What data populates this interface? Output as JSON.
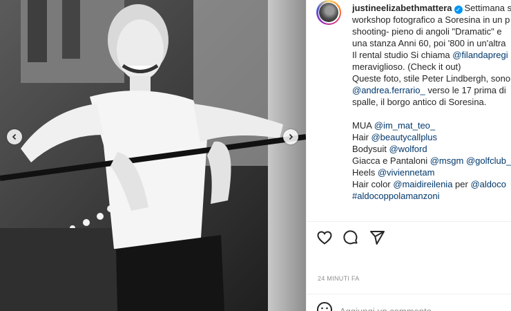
{
  "post": {
    "username": "justineelizabethmattera",
    "caption_lines": [
      {
        "parts": [
          {
            "text": "Settimana s",
            "link": false
          }
        ]
      },
      {
        "parts": [
          {
            "text": "workshop fotografico a Soresina in un p",
            "link": false
          }
        ]
      },
      {
        "parts": [
          {
            "text": "shooting- pieno di angoli \"Dramatic\" e",
            "link": false
          }
        ]
      },
      {
        "parts": [
          {
            "text": "una stanza Anni 60, poi '800 in un'altra",
            "link": false
          }
        ]
      },
      {
        "parts": [
          {
            "text": "Il rental studio Si chiama ",
            "link": false
          },
          {
            "text": "@filandapregi",
            "link": true
          }
        ]
      },
      {
        "parts": [
          {
            "text": "meraviglioso. (Check it out)",
            "link": false
          }
        ]
      },
      {
        "parts": [
          {
            "text": "Queste foto, stile Peter Lindbergh, sono",
            "link": false
          }
        ]
      },
      {
        "parts": [
          {
            "text": "@andrea.ferrario_",
            "link": true
          },
          {
            "text": " verso le 17 prima di",
            "link": false
          }
        ]
      },
      {
        "parts": [
          {
            "text": "spalle, il borgo antico di Soresina.",
            "link": false
          }
        ]
      },
      {
        "parts": []
      },
      {
        "parts": [
          {
            "text": "MUA ",
            "link": false
          },
          {
            "text": "@im_mat_teo_",
            "link": true
          }
        ]
      },
      {
        "parts": [
          {
            "text": "Hair ",
            "link": false
          },
          {
            "text": "@beautycallplus",
            "link": true
          }
        ]
      },
      {
        "parts": [
          {
            "text": "Bodysuit ",
            "link": false
          },
          {
            "text": "@wolford",
            "link": true
          }
        ]
      },
      {
        "parts": [
          {
            "text": "Giacca e Pantaloni ",
            "link": false
          },
          {
            "text": "@msgm",
            "link": true
          },
          {
            "text": " ",
            "link": false
          },
          {
            "text": "@golfclub_",
            "link": true
          }
        ]
      },
      {
        "parts": [
          {
            "text": "Heels ",
            "link": false
          },
          {
            "text": "@viviennetam",
            "link": true
          }
        ]
      },
      {
        "parts": [
          {
            "text": "Hair color ",
            "link": false
          },
          {
            "text": "@maidireilenia",
            "link": true
          },
          {
            "text": " per ",
            "link": false
          },
          {
            "text": "@aldoco",
            "link": true
          }
        ]
      },
      {
        "parts": [
          {
            "text": "#aldocoppolamanzoni",
            "link": true
          }
        ]
      }
    ],
    "timestamp": "24 MINUTI FA",
    "comment_placeholder": "Aggiungi un commento..."
  },
  "icons": {
    "verified": "verified-badge-icon",
    "like": "heart-icon",
    "comment": "comment-bubble-icon",
    "share": "paper-plane-icon",
    "emoji": "smiley-icon",
    "prev": "chevron-left-icon",
    "next": "chevron-right-icon"
  },
  "colors": {
    "link": "#00376b",
    "text": "#262626",
    "muted": "#8e8e8e",
    "verified": "#0095f6"
  }
}
